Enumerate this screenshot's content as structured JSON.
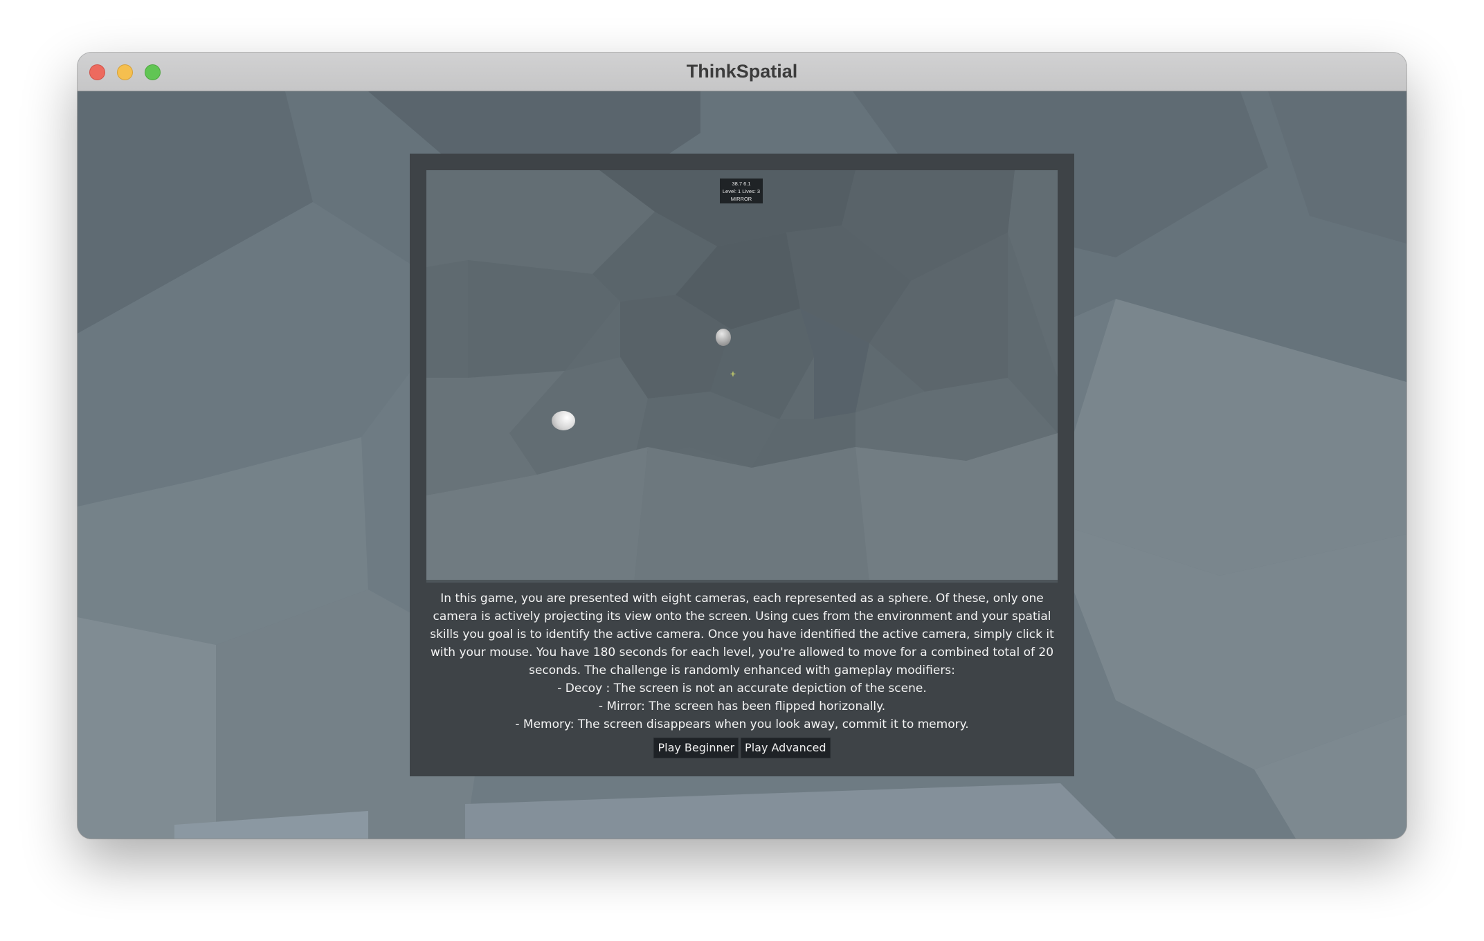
{
  "window": {
    "title": "ThinkSpatial"
  },
  "hud": {
    "line1": "38.7  6.1",
    "line2": "Level: 1 Lives: 3",
    "line3": "MIRROR"
  },
  "description": {
    "intro": "In this game, you are presented with eight cameras, each represented as a sphere. Of these, only one camera is actively projecting its view onto the screen. Using cues from the environment and your spatial skills you goal is to identify the active camera. Once you have identified the active camera, simply click it with your mouse. You have 180 seconds for each level, you're allowed to move for a combined total of 20 seconds. The challenge is randomly enhanced with gameplay modifiers:",
    "decoy": "- Decoy : The screen is not an accurate depiction of the scene.",
    "mirror": "- Mirror: The screen has been flipped horizonally.",
    "memory": "- Memory: The screen disappears when you look away, commit it to memory."
  },
  "buttons": {
    "beginner": "Play Beginner",
    "advanced": "Play Advanced"
  }
}
